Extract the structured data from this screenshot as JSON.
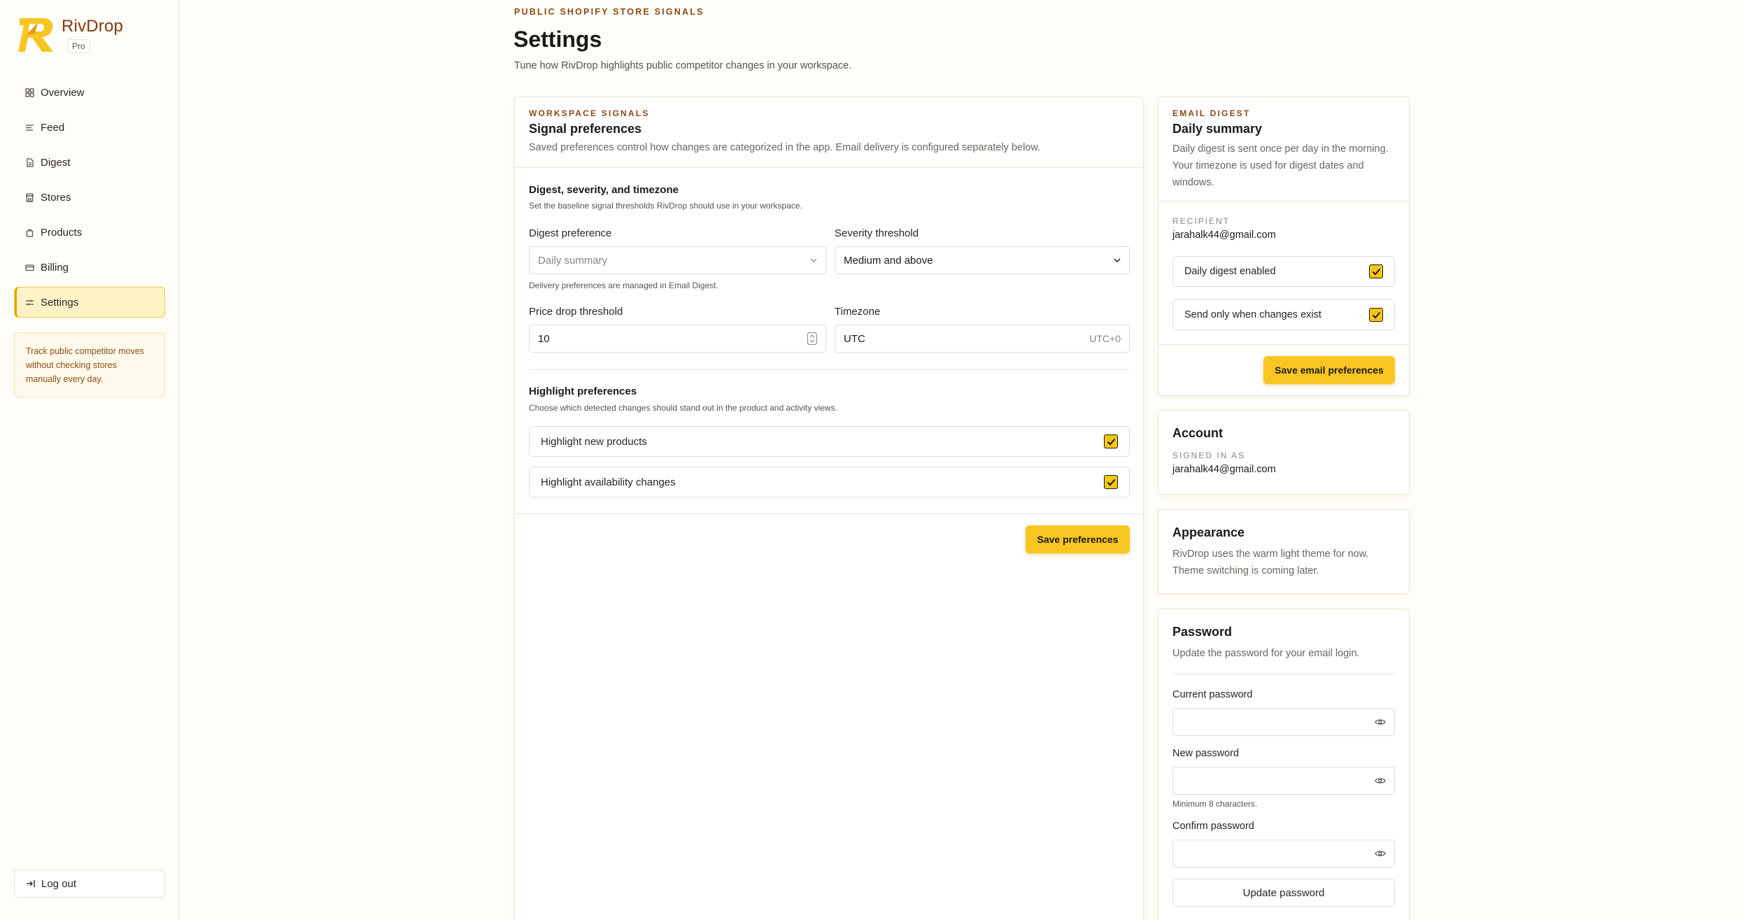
{
  "brand": {
    "name": "RivDrop",
    "plan": "Pro"
  },
  "nav": [
    {
      "label": "Overview",
      "icon": "grid-icon"
    },
    {
      "label": "Feed",
      "icon": "lines-icon"
    },
    {
      "label": "Digest",
      "icon": "doc-icon"
    },
    {
      "label": "Stores",
      "icon": "store-icon"
    },
    {
      "label": "Products",
      "icon": "bag-icon"
    },
    {
      "label": "Billing",
      "icon": "card-icon"
    },
    {
      "label": "Settings",
      "icon": "sliders-icon",
      "active": true
    }
  ],
  "promo": "Track public competitor moves without checking stores manually every day.",
  "logout": "Log out",
  "header": {
    "eyebrow": "PUBLIC SHOPIFY STORE SIGNALS",
    "title": "Settings",
    "subtitle": "Tune how RivDrop highlights public competitor changes in your workspace."
  },
  "signals": {
    "eyebrow": "WORKSPACE SIGNALS",
    "title": "Signal preferences",
    "desc": "Saved preferences control how changes are categorized in the app. Email delivery is configured separately below.",
    "section1_title": "Digest, severity, and timezone",
    "section1_sub": "Set the baseline signal thresholds RivDrop should use in your workspace.",
    "digest_label": "Digest preference",
    "digest_value": "Daily summary",
    "digest_hint": "Delivery preferences are managed in Email Digest.",
    "severity_label": "Severity threshold",
    "severity_value": "Medium and above",
    "price_label": "Price drop threshold",
    "price_value": "10",
    "timezone_label": "Timezone",
    "timezone_value": "UTC",
    "timezone_offset": "UTC+0",
    "section2_title": "Highlight preferences",
    "section2_sub": "Choose which detected changes should stand out in the product and activity views.",
    "check_new_products": "Highlight new products",
    "check_availability": "Highlight availability changes",
    "save": "Save preferences"
  },
  "email_digest": {
    "eyebrow": "EMAIL DIGEST",
    "title": "Daily summary",
    "desc": "Daily digest is sent once per day in the morning. Your timezone is used for digest dates and windows.",
    "recipient_label": "RECIPIENT",
    "recipient": "jarahalk44@gmail.com",
    "check_enabled": "Daily digest enabled",
    "check_changes": "Send only when changes exist",
    "save": "Save email preferences"
  },
  "account": {
    "title": "Account",
    "signed_in_label": "SIGNED IN AS",
    "email": "jarahalk44@gmail.com"
  },
  "appearance": {
    "title": "Appearance",
    "desc": "RivDrop uses the warm light theme for now. Theme switching is coming later."
  },
  "password": {
    "title": "Password",
    "desc": "Update the password for your email login.",
    "current_label": "Current password",
    "new_label": "New password",
    "new_hint": "Minimum 8 characters.",
    "confirm_label": "Confirm password",
    "button": "Update password"
  },
  "colors": {
    "accent": "#f8c623",
    "brand": "#8a4a16"
  }
}
